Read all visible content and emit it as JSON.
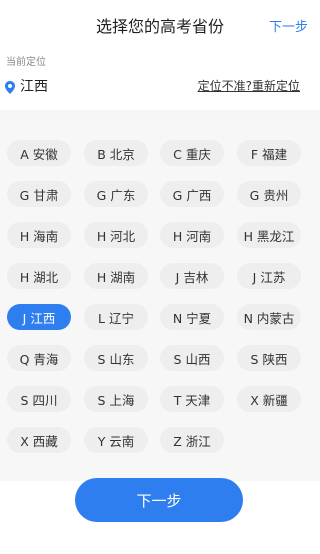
{
  "header": {
    "title": "选择您的高考省份",
    "next_label": "下一步"
  },
  "location": {
    "label": "当前定位",
    "city": "江西",
    "relocate_label": "定位不准?重新定位"
  },
  "provinces": [
    {
      "label": "A 安徽",
      "selected": false
    },
    {
      "label": "B 北京",
      "selected": false
    },
    {
      "label": "C 重庆",
      "selected": false
    },
    {
      "label": "F 福建",
      "selected": false
    },
    {
      "label": "G 甘肃",
      "selected": false
    },
    {
      "label": "G 广东",
      "selected": false
    },
    {
      "label": "G 广西",
      "selected": false
    },
    {
      "label": "G 贵州",
      "selected": false
    },
    {
      "label": "H 海南",
      "selected": false
    },
    {
      "label": "H 河北",
      "selected": false
    },
    {
      "label": "H 河南",
      "selected": false
    },
    {
      "label": "H 黑龙江",
      "selected": false
    },
    {
      "label": "H 湖北",
      "selected": false
    },
    {
      "label": "H 湖南",
      "selected": false
    },
    {
      "label": "J 吉林",
      "selected": false
    },
    {
      "label": "J 江苏",
      "selected": false
    },
    {
      "label": "J 江西",
      "selected": true
    },
    {
      "label": "L 辽宁",
      "selected": false
    },
    {
      "label": "N 宁夏",
      "selected": false
    },
    {
      "label": "N 内蒙古",
      "selected": false
    },
    {
      "label": "Q 青海",
      "selected": false
    },
    {
      "label": "S 山东",
      "selected": false
    },
    {
      "label": "S 山西",
      "selected": false
    },
    {
      "label": "S 陕西",
      "selected": false
    },
    {
      "label": "S 四川",
      "selected": false
    },
    {
      "label": "S 上海",
      "selected": false
    },
    {
      "label": "T 天津",
      "selected": false
    },
    {
      "label": "X 新疆",
      "selected": false
    },
    {
      "label": "X 西藏",
      "selected": false
    },
    {
      "label": "Y 云南",
      "selected": false
    },
    {
      "label": "Z 浙江",
      "selected": false
    }
  ],
  "footer": {
    "next_label": "下一步"
  },
  "colors": {
    "accent": "#2f7ef0",
    "chip_bg": "#eeeeee",
    "grid_bg": "#f7f7f7"
  },
  "icons": {
    "location": "location-pin-icon"
  }
}
